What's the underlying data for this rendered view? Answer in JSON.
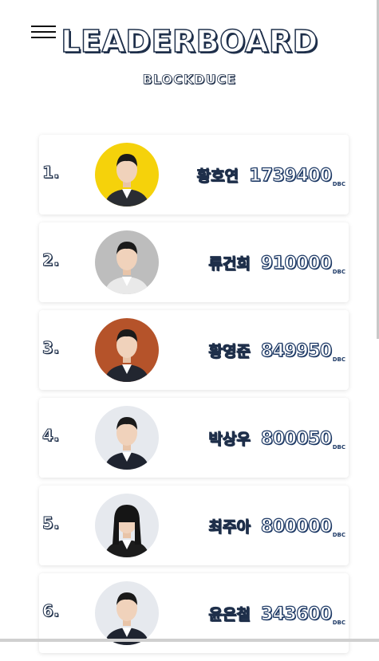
{
  "header": {
    "title": "LEADERBOARD",
    "subtitle": "BLOCKDUCE",
    "menu_icon": "hamburger-menu-icon"
  },
  "unit": "DBC",
  "entries": [
    {
      "rank": "1.",
      "name": "황호연",
      "score": "1739400",
      "avatar_bg": "#f5d20b",
      "suit": "#2a2d33"
    },
    {
      "rank": "2.",
      "name": "류건희",
      "score": "910000",
      "avatar_bg": "#bdbdbd",
      "suit": "#e9e9e9"
    },
    {
      "rank": "3.",
      "name": "황영준",
      "score": "849950",
      "avatar_bg": "#b5532a",
      "suit": "#222630"
    },
    {
      "rank": "4.",
      "name": "박상우",
      "score": "800050",
      "avatar_bg": "#e6e9ee",
      "suit": "#1f2430"
    },
    {
      "rank": "5.",
      "name": "최주아",
      "score": "800000",
      "avatar_bg": "#e6e9ee",
      "suit": "#1c1c1c"
    },
    {
      "rank": "6.",
      "name": "윤은철",
      "score": "343600",
      "avatar_bg": "#e6e9ee",
      "suit": "#1f2430"
    }
  ],
  "colors": {
    "outline": "#1e2f4a",
    "score_outline": "#1e3a66"
  }
}
